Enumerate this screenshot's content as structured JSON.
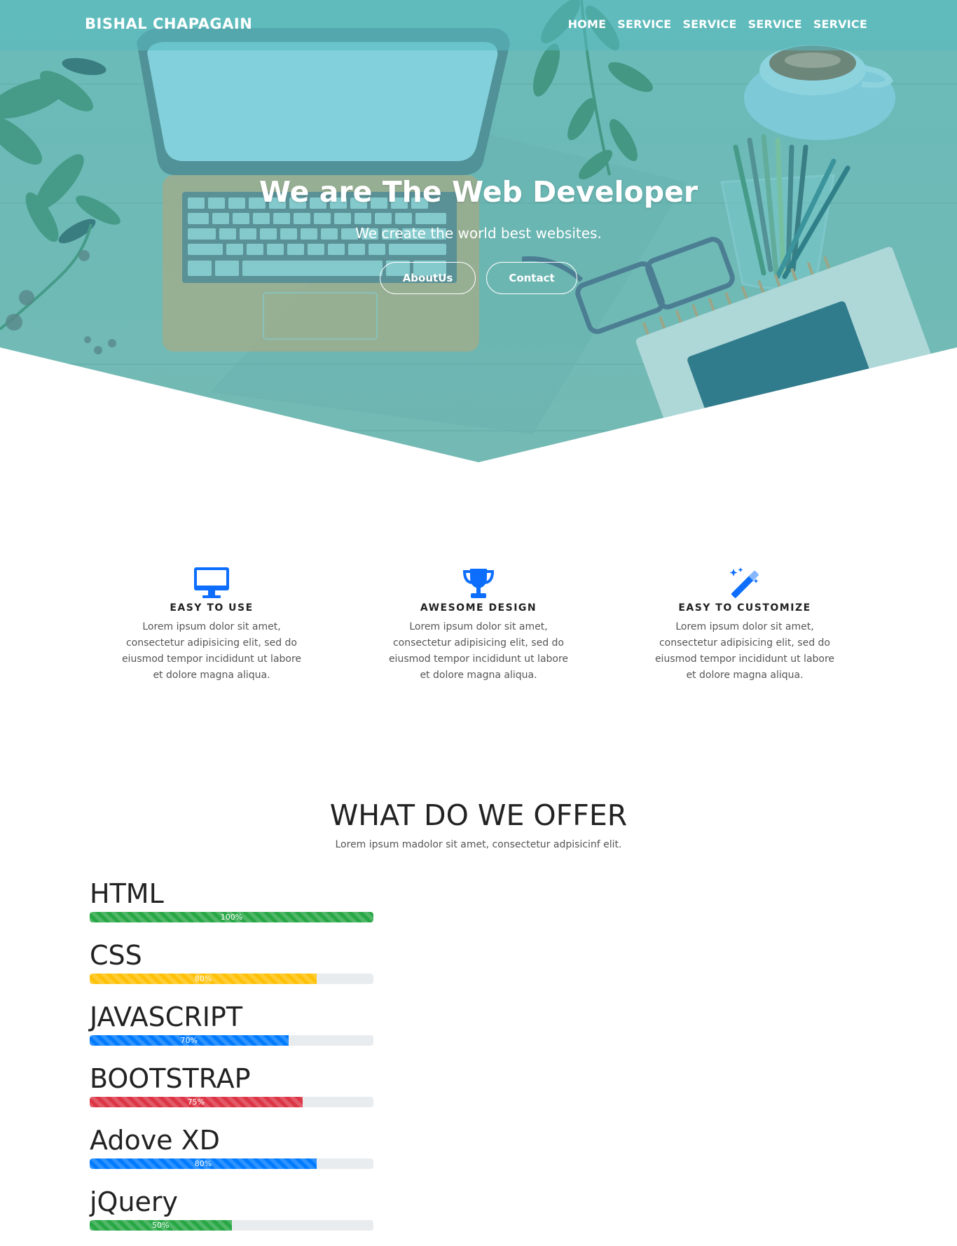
{
  "navbar": {
    "brand": "BISHAL CHAPAGAIN",
    "links": [
      "HOME",
      "SERVICE",
      "SERVICE",
      "SERVICE",
      "SERVICE"
    ]
  },
  "hero": {
    "title": "We are The Web Developer",
    "subtitle": "We create the world best websites.",
    "buttons": [
      "AboutUs",
      "Contact"
    ]
  },
  "features": [
    {
      "icon": "desktop-monitor-icon",
      "title": "EASY TO USE",
      "text": "Lorem ipsum dolor sit amet, consectetur adipisicing elit, sed do eiusmod tempor incididunt ut labore et dolore magna aliqua."
    },
    {
      "icon": "trophy-icon",
      "title": "AWESOME DESIGN",
      "text": "Lorem ipsum dolor sit amet, consectetur adipisicing elit, sed do eiusmod tempor incididunt ut labore et dolore magna aliqua."
    },
    {
      "icon": "magic-wand-icon",
      "title": "EASY TO CUSTOMIZE",
      "text": "Lorem ipsum dolor sit amet, consectetur adipisicing elit, sed do eiusmod tempor incididunt ut labore et dolore magna aliqua."
    }
  ],
  "offer": {
    "title": "WHAT DO WE OFFER",
    "subtitle": "Lorem ipsum madolor sit amet, consectetur adpisicinf elit.",
    "skills": [
      {
        "name": "HTML",
        "percent": 100,
        "label": "100%",
        "color": "#28a745"
      },
      {
        "name": "CSS",
        "percent": 80,
        "label": "80%",
        "color": "#ffc107"
      },
      {
        "name": "JAVASCRIPT",
        "percent": 70,
        "label": "70%",
        "color": "#007bff"
      },
      {
        "name": "BOOTSTRAP",
        "percent": 75,
        "label": "75%",
        "color": "#dc3545"
      },
      {
        "name": "Adove XD",
        "percent": 80,
        "label": "80%",
        "color": "#007bff"
      },
      {
        "name": "jQuery",
        "percent": 50,
        "label": "50%",
        "color": "#28a745"
      }
    ]
  },
  "colors": {
    "accent": "#007bff",
    "hero_overlay": "#6fbab6"
  }
}
